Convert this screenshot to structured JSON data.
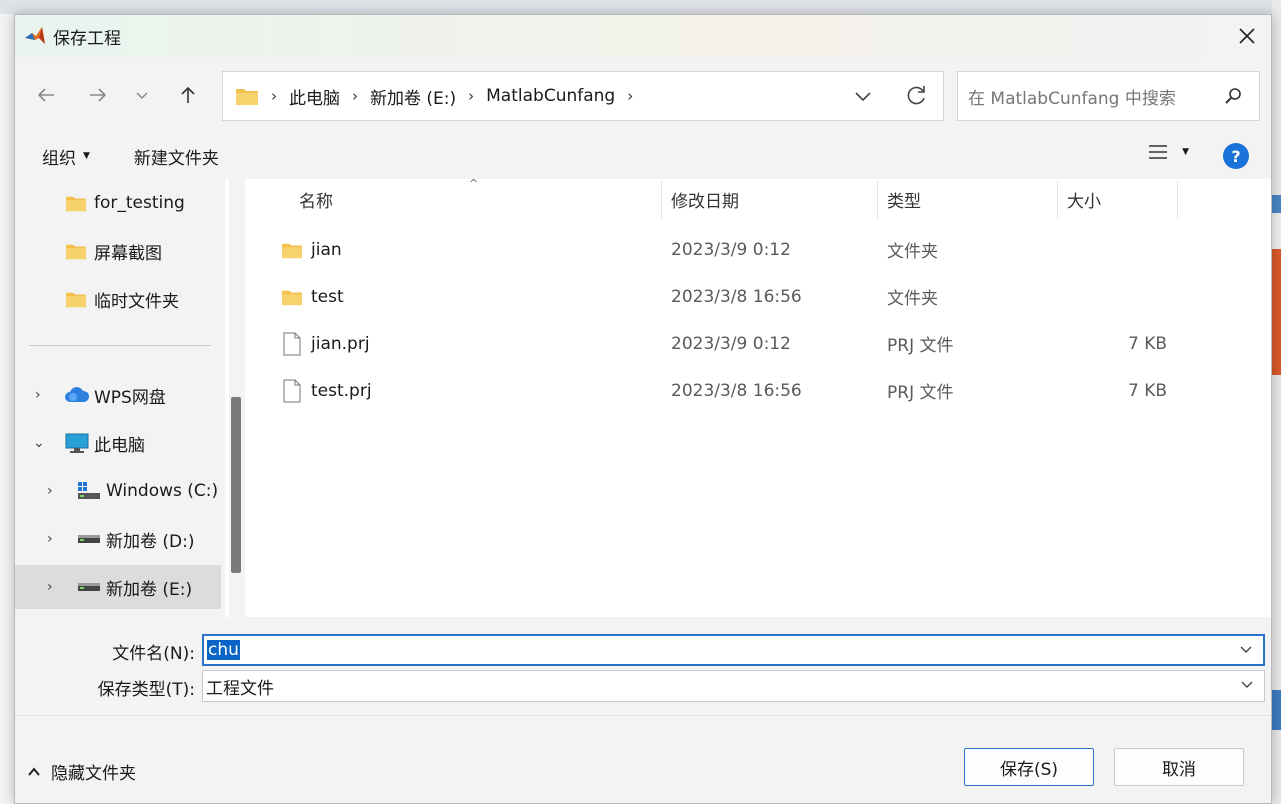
{
  "window": {
    "title": "保存工程"
  },
  "nav": {
    "breadcrumb": [
      "此电脑",
      "新加卷 (E:)",
      "MatlabCunfang"
    ],
    "search_placeholder": "在 MatlabCunfang 中搜索"
  },
  "toolbar": {
    "organize": "组织",
    "new_folder": "新建文件夹",
    "help": "?"
  },
  "sidebar": {
    "items": [
      {
        "label": "for_testing",
        "icon": "folder-icon"
      },
      {
        "label": "屏幕截图",
        "icon": "folder-icon"
      },
      {
        "label": "临时文件夹",
        "icon": "folder-icon"
      },
      {
        "label": "WPS网盘",
        "icon": "cloud-icon"
      },
      {
        "label": "此电脑",
        "icon": "computer-icon"
      },
      {
        "label": "Windows (C:)",
        "icon": "windows-drive-icon"
      },
      {
        "label": "新加卷 (D:)",
        "icon": "drive-icon"
      },
      {
        "label": "新加卷 (E:)",
        "icon": "drive-icon"
      }
    ]
  },
  "columns": {
    "name": "名称",
    "modified": "修改日期",
    "type": "类型",
    "size": "大小"
  },
  "files": [
    {
      "name": "jian",
      "modified": "2023/3/9 0:12",
      "type": "文件夹",
      "size": "",
      "icon": "folder-icon"
    },
    {
      "name": "test",
      "modified": "2023/3/8 16:56",
      "type": "文件夹",
      "size": "",
      "icon": "folder-icon"
    },
    {
      "name": "jian.prj",
      "modified": "2023/3/9 0:12",
      "type": "PRJ 文件",
      "size": "7 KB",
      "icon": "file-icon"
    },
    {
      "name": "test.prj",
      "modified": "2023/3/8 16:56",
      "type": "PRJ 文件",
      "size": "7 KB",
      "icon": "file-icon"
    }
  ],
  "form": {
    "filename_label": "文件名(N):",
    "filename_value": "chu",
    "filetype_label": "保存类型(T):",
    "filetype_value": "工程文件"
  },
  "footer": {
    "hide_folders": "隐藏文件夹",
    "save": "保存(S)",
    "cancel": "取消"
  },
  "colors": {
    "accent": "#1a73d9",
    "folder": "#f2c14e",
    "selection": "#0a64c8"
  }
}
